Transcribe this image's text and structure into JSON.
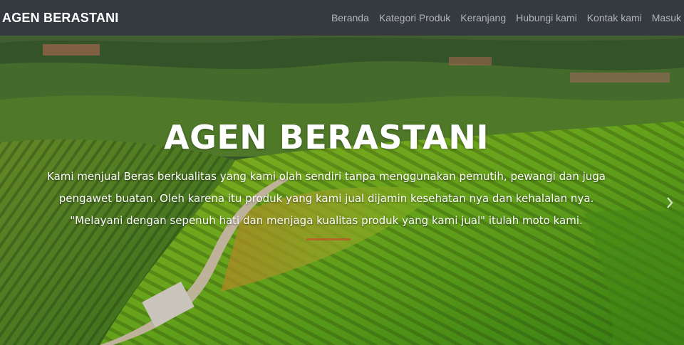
{
  "navbar": {
    "brand": "AGEN BERASTANI",
    "links": [
      "Beranda",
      "Kategori Produk",
      "Keranjang",
      "Hubungi kami",
      "Kontak kami",
      "Masuk"
    ]
  },
  "hero": {
    "title": "AGEN BERASTANI",
    "description_lines": [
      "Kami menjual Beras berkualitas yang kami olah sendiri tanpa menggunakan pemutih, pewangi dan juga",
      "pengawet buatan. Oleh karena itu produk yang kami jual dijamin kesehatan nya dan kehalalan nya.",
      "\"Melayani dengan sepenuh hati dan menjaga kualitas produk yang kami jual\" itulah moto kami."
    ],
    "next_icon": "chevron-right-icon"
  },
  "colors": {
    "navbar_bg": "#343a40",
    "brand": "#ffffff",
    "nav_link": "#a9adb1"
  }
}
